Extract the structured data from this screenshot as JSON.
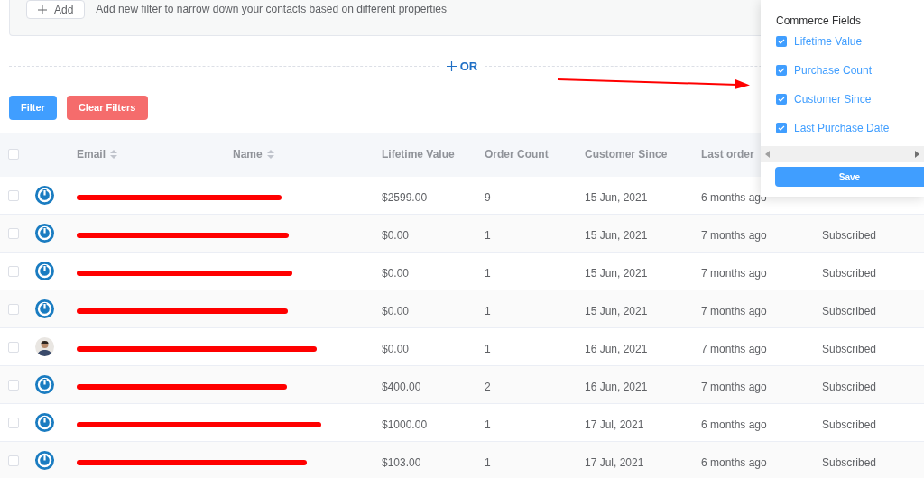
{
  "filter_box": {
    "add_button": "Add",
    "hint": "Add new filter to narrow down your contacts based on different properties"
  },
  "or_button": "OR",
  "buttons": {
    "filter": "Filter",
    "clear": "Clear Filters"
  },
  "table": {
    "select_all": {
      "checked": false
    },
    "columns": [
      {
        "label": "Email",
        "sortable": true
      },
      {
        "label": "Name",
        "sortable": true
      },
      {
        "label": "Lifetime Value",
        "sortable": false
      },
      {
        "label": "Order Count",
        "sortable": false
      },
      {
        "label": "Customer Since",
        "sortable": false
      },
      {
        "label": "Last order",
        "sortable": false
      }
    ],
    "rows": [
      {
        "checked": false,
        "kind": "logo",
        "lifetime_value": "$2599.00",
        "order_count": "9",
        "customer_since": "15 Jun, 2021",
        "last_order": "6 months ago"
      },
      {
        "checked": false,
        "kind": "logo",
        "lifetime_value": "$0.00",
        "order_count": "1",
        "customer_since": "15 Jun, 2021",
        "last_order": "7 months ago",
        "status": "Subscribed"
      },
      {
        "checked": false,
        "kind": "logo",
        "lifetime_value": "$0.00",
        "order_count": "1",
        "customer_since": "15 Jun, 2021",
        "last_order": "7 months ago",
        "status": "Subscribed"
      },
      {
        "checked": false,
        "kind": "logo",
        "lifetime_value": "$0.00",
        "order_count": "1",
        "customer_since": "15 Jun, 2021",
        "last_order": "7 months ago",
        "status": "Subscribed"
      },
      {
        "checked": false,
        "lifetime_value": "$0.00",
        "order_count": "1",
        "customer_since": "16 Jun, 2021",
        "last_order": "7 months ago",
        "status": "Subscribed"
      },
      {
        "checked": false,
        "kind": "logo",
        "lifetime_value": "$400.00",
        "order_count": "2",
        "customer_since": "16 Jun, 2021",
        "last_order": "7 months ago",
        "status": "Subscribed"
      },
      {
        "checked": false,
        "kind": "logo",
        "lifetime_value": "$1000.00",
        "order_count": "1",
        "customer_since": "17 Jul, 2021",
        "last_order": "6 months ago",
        "status": "Subscribed"
      },
      {
        "checked": false,
        "kind": "logo",
        "lifetime_value": "$103.00",
        "order_count": "1",
        "customer_since": "17 Jul, 2021",
        "last_order": "6 months ago",
        "status": "Subscribed"
      }
    ]
  },
  "columns_popup": {
    "title": "Commerce Fields",
    "fields": [
      {
        "label": "Lifetime Value",
        "checked": true
      },
      {
        "label": "Purchase Count",
        "checked": true
      },
      {
        "label": "Customer Since",
        "checked": true
      },
      {
        "label": "Last Purchase Date",
        "checked": true
      }
    ],
    "save_button": "Save"
  }
}
